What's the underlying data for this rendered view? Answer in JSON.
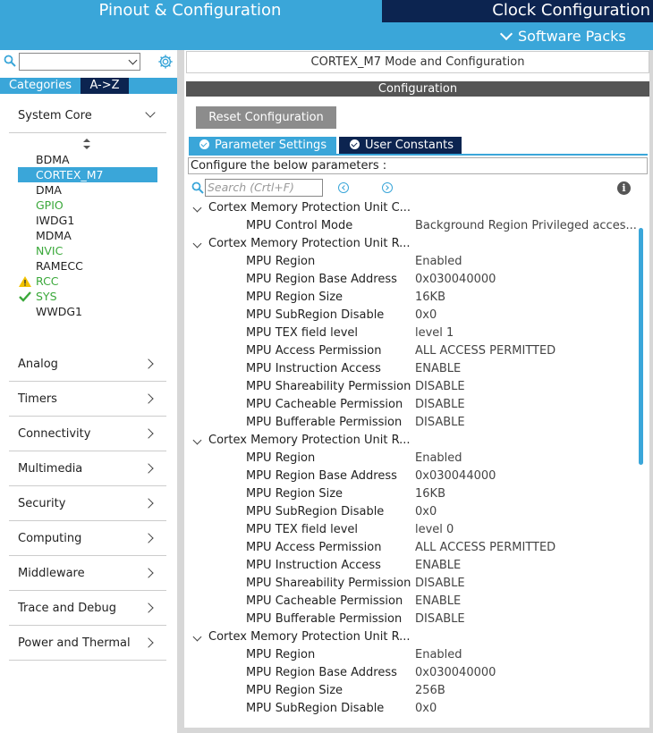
{
  "header": {
    "pinout_tab": "Pinout & Configuration",
    "clock_tab": "Clock Configuration",
    "software_packs": "Software Packs"
  },
  "left": {
    "search_value": "",
    "tabs": [
      "Categories",
      "A->Z"
    ],
    "system_core": {
      "label": "System Core",
      "items": [
        {
          "label": "BDMA",
          "status": "normal"
        },
        {
          "label": "CORTEX_M7",
          "status": "selected"
        },
        {
          "label": "DMA",
          "status": "normal"
        },
        {
          "label": "GPIO",
          "status": "green"
        },
        {
          "label": "IWDG1",
          "status": "normal"
        },
        {
          "label": "MDMA",
          "status": "normal"
        },
        {
          "label": "NVIC",
          "status": "green"
        },
        {
          "label": "RAMECC",
          "status": "normal"
        },
        {
          "label": "RCC",
          "status": "warning"
        },
        {
          "label": "SYS",
          "status": "check"
        },
        {
          "label": "WWDG1",
          "status": "normal"
        }
      ]
    },
    "categories": [
      "Analog",
      "Timers",
      "Connectivity",
      "Multimedia",
      "Security",
      "Computing",
      "Middleware",
      "Trace and Debug",
      "Power and Thermal"
    ]
  },
  "right": {
    "mode_title": "CORTEX_M7 Mode and Configuration",
    "config_title": "Configuration",
    "reset_button": "Reset Configuration",
    "tabs": [
      "Parameter Settings",
      "User Constants"
    ],
    "prompt": "Configure the below parameters :",
    "search_placeholder": "Search (Crtl+F)",
    "info": "i",
    "groups": [
      {
        "title": "Cortex Memory Protection Unit C...",
        "params": [
          {
            "k": "MPU Control Mode",
            "v": "Background Region Privileged acces..."
          }
        ]
      },
      {
        "title": "Cortex Memory Protection Unit R...",
        "params": [
          {
            "k": "MPU Region",
            "v": "Enabled"
          },
          {
            "k": "MPU Region Base Address",
            "v": "0x030040000"
          },
          {
            "k": "MPU Region Size",
            "v": "16KB"
          },
          {
            "k": "MPU SubRegion Disable",
            "v": "0x0"
          },
          {
            "k": "MPU TEX field level",
            "v": "level 1"
          },
          {
            "k": "MPU Access Permission",
            "v": "ALL ACCESS PERMITTED"
          },
          {
            "k": "MPU Instruction Access",
            "v": "ENABLE"
          },
          {
            "k": "MPU Shareability Permission",
            "v": "DISABLE"
          },
          {
            "k": "MPU Cacheable Permission",
            "v": "DISABLE"
          },
          {
            "k": "MPU Bufferable  Permission",
            "v": "DISABLE"
          }
        ]
      },
      {
        "title": "Cortex Memory Protection Unit R...",
        "params": [
          {
            "k": "MPU Region",
            "v": "Enabled"
          },
          {
            "k": "MPU Region Base Address",
            "v": "0x030044000"
          },
          {
            "k": "MPU Region Size",
            "v": "16KB"
          },
          {
            "k": "MPU SubRegion Disable",
            "v": "0x0"
          },
          {
            "k": "MPU TEX field level",
            "v": "level 0"
          },
          {
            "k": "MPU Access Permission",
            "v": "ALL ACCESS PERMITTED"
          },
          {
            "k": "MPU Instruction Access",
            "v": "ENABLE"
          },
          {
            "k": "MPU Shareability Permission",
            "v": "DISABLE"
          },
          {
            "k": "MPU Cacheable Permission",
            "v": "ENABLE"
          },
          {
            "k": "MPU Bufferable  Permission",
            "v": "DISABLE"
          }
        ]
      },
      {
        "title": "Cortex Memory Protection Unit R...",
        "params": [
          {
            "k": "MPU Region",
            "v": "Enabled"
          },
          {
            "k": "MPU Region Base Address",
            "v": "0x030040000"
          },
          {
            "k": "MPU Region Size",
            "v": "256B"
          },
          {
            "k": "MPU SubRegion Disable",
            "v": "0x0"
          }
        ]
      }
    ]
  },
  "colors": {
    "accent": "#3aa6d9",
    "dark": "#0c2450",
    "green": "#3aa83a",
    "warning": "#f2c200"
  }
}
